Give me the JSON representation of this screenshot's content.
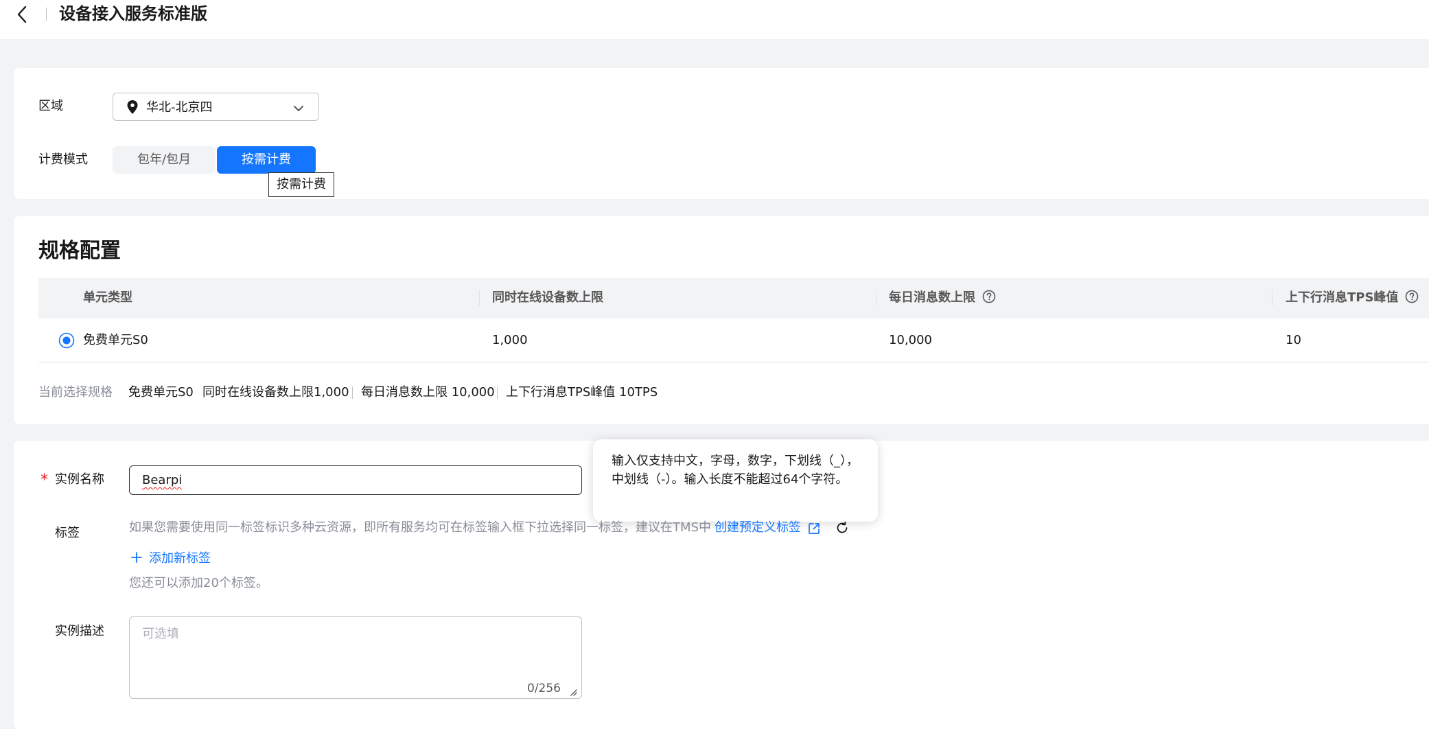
{
  "header": {
    "title": "设备接入服务标准版",
    "back_icon": "chevron-left-icon"
  },
  "region": {
    "label": "区域",
    "value": "华北-北京四",
    "icon": "location-pin-icon"
  },
  "billing": {
    "label": "计费模式",
    "options": [
      "包年/包月",
      "按需计费"
    ],
    "selected": "按需计费",
    "tooltip": "按需计费"
  },
  "spec": {
    "title": "规格配置",
    "columns": [
      "单元类型",
      "同时在线设备数上限",
      "每日消息数上限",
      "上下行消息TPS峰值"
    ],
    "rows": [
      {
        "selected": true,
        "type": "免费单元S0",
        "online": "1,000",
        "daily": "10,000",
        "tps": "10"
      }
    ],
    "summary": {
      "label": "当前选择规格",
      "unit": "免费单元S0",
      "online": "同时在线设备数上限1,000",
      "daily": "每日消息数上限 10,000",
      "tps": "上下行消息TPS峰值 10TPS"
    }
  },
  "instance": {
    "name_label": "实例名称",
    "required_mark": "*",
    "name_value": "Bearpi",
    "hint": "输入仅支持中文，字母，数字，下划线（_），中划线（-）。输入长度不能超过64个字符。",
    "tag_label": "标签",
    "tag_desc": "如果您需要使用同一标签标识多种云资源，即所有服务均可在标签输入框下拉选择同一标签，建议在TMS中",
    "tag_link": "创建预定义标签",
    "add_tag": "添加新标签",
    "remain": "您还可以添加20个标签。",
    "desc_label": "实例描述",
    "desc_placeholder": "可选填",
    "desc_count": "0/256"
  },
  "colors": {
    "primary": "#1476ff",
    "required": "#e8211f",
    "background": "#f2f3f5"
  }
}
